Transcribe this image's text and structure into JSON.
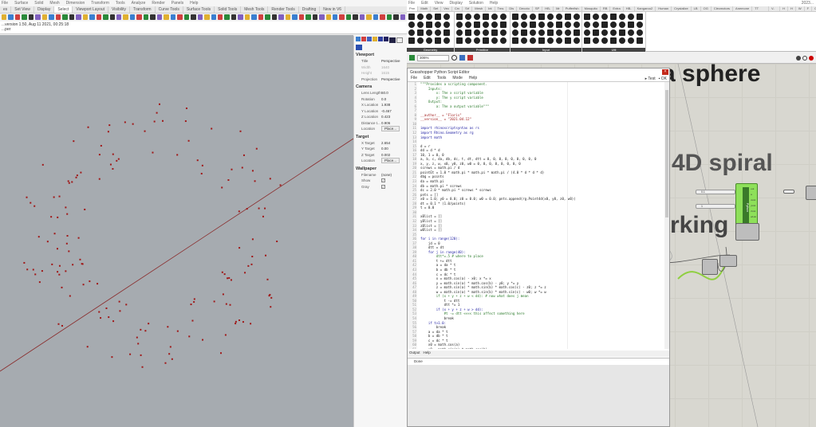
{
  "rhino": {
    "menu": [
      "File",
      "Surface",
      "Solid",
      "Mesh",
      "Dimension",
      "Transform",
      "Tools",
      "Analyze",
      "Render",
      "Panels",
      "Help"
    ],
    "tabs": [
      "es",
      "Set View",
      "Display",
      "Select",
      "Viewport Layout",
      "Visibility",
      "Transform",
      "Curve Tools",
      "Surface Tools",
      "Solid Tools",
      "Mesh Tools",
      "Render Tools",
      "Drafting",
      "New in V6"
    ],
    "active_tab": "Select",
    "command_history": "...version 1.50, Aug 11 2021, 00:25:18",
    "command_prompt": "...per"
  },
  "properties": {
    "viewport": {
      "title": "Viewport",
      "rows": [
        {
          "k": "Title",
          "v": "Perspective"
        },
        {
          "k": "Width",
          "v": "1640",
          "dim": true
        },
        {
          "k": "Height",
          "v": "1615",
          "dim": true
        },
        {
          "k": "Projection",
          "v": "Perspective"
        }
      ]
    },
    "camera": {
      "title": "Camera",
      "rows": [
        {
          "k": "Lens Length",
          "v": "50.0"
        },
        {
          "k": "Rotation",
          "v": "0.0"
        },
        {
          "k": "X Location",
          "v": "1.938"
        },
        {
          "k": "Y Location",
          "v": "-0.467"
        },
        {
          "k": "Z Location",
          "v": "0.423"
        },
        {
          "k": "Distance t...",
          "v": "0.906"
        }
      ],
      "location_label": "Location",
      "place_button": "Place..."
    },
    "target": {
      "title": "Target",
      "rows": [
        {
          "k": "X Target",
          "v": "2.654"
        },
        {
          "k": "Y Target",
          "v": "0.00"
        },
        {
          "k": "Z Target",
          "v": "0.002"
        }
      ],
      "location_label": "Location",
      "place_button": "Place..."
    },
    "wallpaper": {
      "title": "Wallpaper",
      "filename_label": "Filename",
      "filename_value": "(none)",
      "show_label": "Show",
      "gray_label": "Gray",
      "show": true,
      "gray": true
    }
  },
  "gh": {
    "menu": [
      "File",
      "Edit",
      "View",
      "Display",
      "Solution",
      "Help"
    ],
    "doc_name": "2023...",
    "tabs": [
      "Prm",
      "Math",
      "Set",
      "Vec",
      "Crv",
      "Srf",
      "Mesh",
      "Int",
      "Trns",
      "Dis",
      "Decoto",
      "SP",
      "HB-E",
      "Mr",
      "Pufferfish",
      "Mosquito",
      "RB",
      "Extra",
      "HB-R",
      "Kangaroo2",
      "Human",
      "Crystalize",
      "LB",
      "OG",
      "Clecmotors",
      "Anemone",
      "TT Toolbox",
      "V-Ray",
      "H",
      "H",
      "W",
      "F",
      "C",
      "I",
      "O"
    ],
    "active_tab": "Prm",
    "groups": [
      "Geometry",
      "Primitive",
      "Input",
      "Util"
    ],
    "zoom": "306%",
    "canvas_labels": [
      "a sphere",
      "4D spiral",
      "rking"
    ],
    "python_component": "Python",
    "python_outputs": [
      "out",
      "a",
      "xList",
      "yList",
      "zList",
      "wList"
    ],
    "slider_values": [
      "0.1",
      "1"
    ]
  },
  "editor": {
    "title": "Grasshopper Python Script Editor",
    "menu": [
      "File",
      "Edit",
      "Tools",
      "Mode",
      "Help"
    ],
    "test_button": "Test",
    "ok_button": "OK",
    "code": [
      "\"\"\"Provides a scripting component.",
      "    Inputs:",
      "        x: The x script variable",
      "        y: The y script variable",
      "    Output:",
      "        a: The a output variable\"\"\"",
      "",
      "__author__ = \"Floris\"",
      "__version__ = \"2021.04.12\"",
      "",
      "import rhinoscriptsyntax as rs",
      "import Rhino.Geometry as rg",
      "import math",
      "",
      "d = r",
      "dd = d * d",
      "10, 1 = 0, 0",
      "a, b, c, da, db, dc, t, dt, dtt = 0, 0, 0, 0, 0, 0, 0, 0, 0",
      "x, y, z, w, x0, y0, z0, w0 = 0, 0, 0, 0, 0, 0, 0, 0",
      "screws = math.pi / d",
      "pointEt = 1.0 * math.pi * math.pi * math.pi / (4.0 * d * d * d)",
      "dbg = points",
      "da = math.pi",
      "db = math.pi * screws",
      "dc = 2.0 * math.pi * screws * screws",
      "pnts = []",
      "x0 = 1.0; y0 = 0.0; z0 = 0.0; w0 = 0.0; pnts.append(rg.Point4d(x0, y0, z0, w0))",
      "dt = 0.1 * (1.0/points)",
      "t = 0.0",
      "",
      "xBlist = []",
      "yBlist = []",
      "zBlist = []",
      "wBlist = []",
      "",
      "for i in range(120):",
      "    jd = 0",
      "    dtt = dt",
      "    for j in range(40):",
      "        dtt*=.5 # where to place",
      "        t += dtt",
      "        a = da * t",
      "        b = db * t",
      "        c = dc * t",
      "        x = math.cos(a) - x0; x *= x",
      "        y = math.sin(a) * math.cos(b) - y0; y *= y",
      "        z = math.sin(a) * math.sin(b) * math.cos(c) - z0; z *= z",
      "        w = math.sin(a) * math.sin(b) * math.sin(c) - w0; w *= w",
      "        if (x + y + z + w < dd): # now what does j mean",
      "            t -= dtt",
      "            dtt *= 1",
      "        if (x + y + z + w > dd):",
      "            #t -= dtt <<<< this affect something here",
      "            break",
      "    if t>1.0:",
      "        break",
      "    a = da * t",
      "    b = db * t",
      "    c = dc * t",
      "    x0 = math.cos(a)",
      "    y0 = math.sin(a) * math.cos(b)"
    ],
    "output_tabs": [
      "Output",
      "Help"
    ],
    "output_text": "Done"
  }
}
